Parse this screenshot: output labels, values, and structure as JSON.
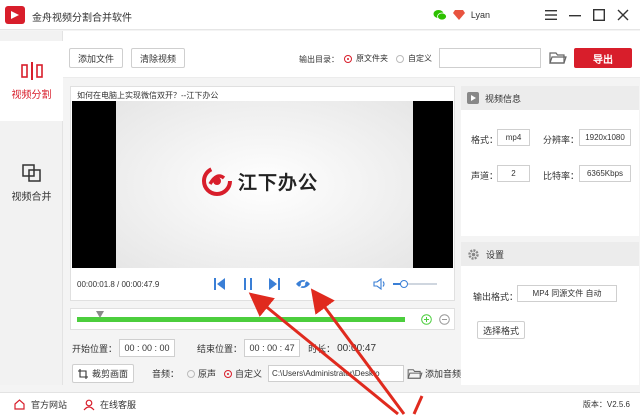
{
  "app": {
    "title": "金舟视频分割合并软件",
    "username": "Lyan",
    "version_label": "版本：",
    "version": "V2.5.6"
  },
  "sidebar": {
    "items": [
      {
        "label": "视频分割",
        "active": true
      },
      {
        "label": "视频合并",
        "active": false
      }
    ]
  },
  "toolbar": {
    "add_file": "添加文件",
    "clear_video": "清除视频",
    "output_dir_label": "输出目录：",
    "option_source": "原文件夹",
    "option_custom": "自定义",
    "output_path_value": "",
    "export": "导出"
  },
  "video": {
    "title": "如何在电脑上实现微信双开？--江下办公",
    "brand": "江下办公",
    "current_time": "00:00:01.8",
    "total_time": "00:00:47.9",
    "volume_level": 0.25
  },
  "timeline": {
    "start_fraction": 0.07,
    "progress_fraction": 1.0
  },
  "range": {
    "start_label": "开始位置：",
    "start": [
      "00",
      "00",
      "00"
    ],
    "end_label": "结束位置：",
    "end": [
      "00",
      "00",
      "47"
    ],
    "duration_label": "时长：",
    "duration": "00:00:47"
  },
  "crop": {
    "crop_button": "裁剪画面",
    "audio_label": "音频：",
    "audio_original": "原声",
    "audio_custom": "自定义",
    "audio_path": "C:\\Users\\Administrator\\Deskto",
    "add_audio": "添加音频"
  },
  "info": {
    "header": "视频信息",
    "format_label": "格式：",
    "format": "mp4",
    "resolution_label": "分辨率：",
    "resolution": "1920x1080",
    "channels_label": "声道：",
    "channels": "2",
    "bitrate_label": "比特率：",
    "bitrate": "6365Kbps"
  },
  "settings": {
    "header": "设置",
    "output_format_label": "输出格式：",
    "output_format": "MP4 同源文件 自动",
    "choose_format": "选择格式"
  },
  "footer": {
    "official_site": "官方网站",
    "online_support": "在线客服"
  },
  "colors": {
    "accent": "#d81e2b",
    "progress": "#4cce3d",
    "control_blue": "#3a7fd6"
  }
}
